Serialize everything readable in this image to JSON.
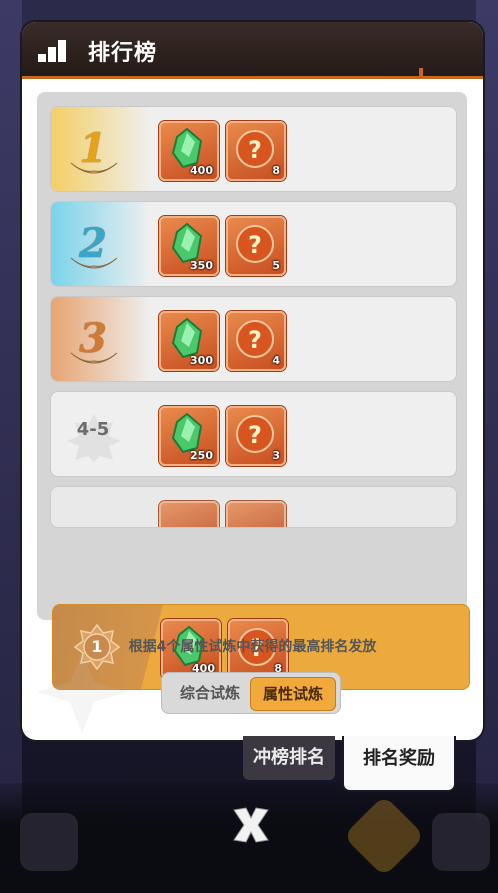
{
  "header": {
    "title": "排行榜",
    "icon": "ranking-bars-icon"
  },
  "colors": {
    "gold": "#f3c24d",
    "silver_blue": "#5cc4e0",
    "bronze": "#d88a4a",
    "highlight": "#ecaa3e",
    "item_bg": "#d9642b"
  },
  "reward_items": {
    "gem": "green-crystal-icon",
    "mystery": "question-orb-icon"
  },
  "ranks": [
    {
      "label": "1",
      "gem_count": "400",
      "orb_count": "8"
    },
    {
      "label": "2",
      "gem_count": "350",
      "orb_count": "5"
    },
    {
      "label": "3",
      "gem_count": "300",
      "orb_count": "4"
    },
    {
      "label": "4-5",
      "gem_count": "250",
      "orb_count": "3"
    }
  ],
  "my_rank": {
    "label": "1",
    "gem_count": "400",
    "orb_count": "8"
  },
  "note": "根据4个属性试炼中获得的最高排名发放",
  "toggle": {
    "option_a": "综合试炼",
    "option_b": "属性试炼",
    "selected": "属性试炼"
  },
  "tabs": {
    "left": "冲榜排名",
    "right": "排名奖励",
    "active": "排名奖励"
  }
}
